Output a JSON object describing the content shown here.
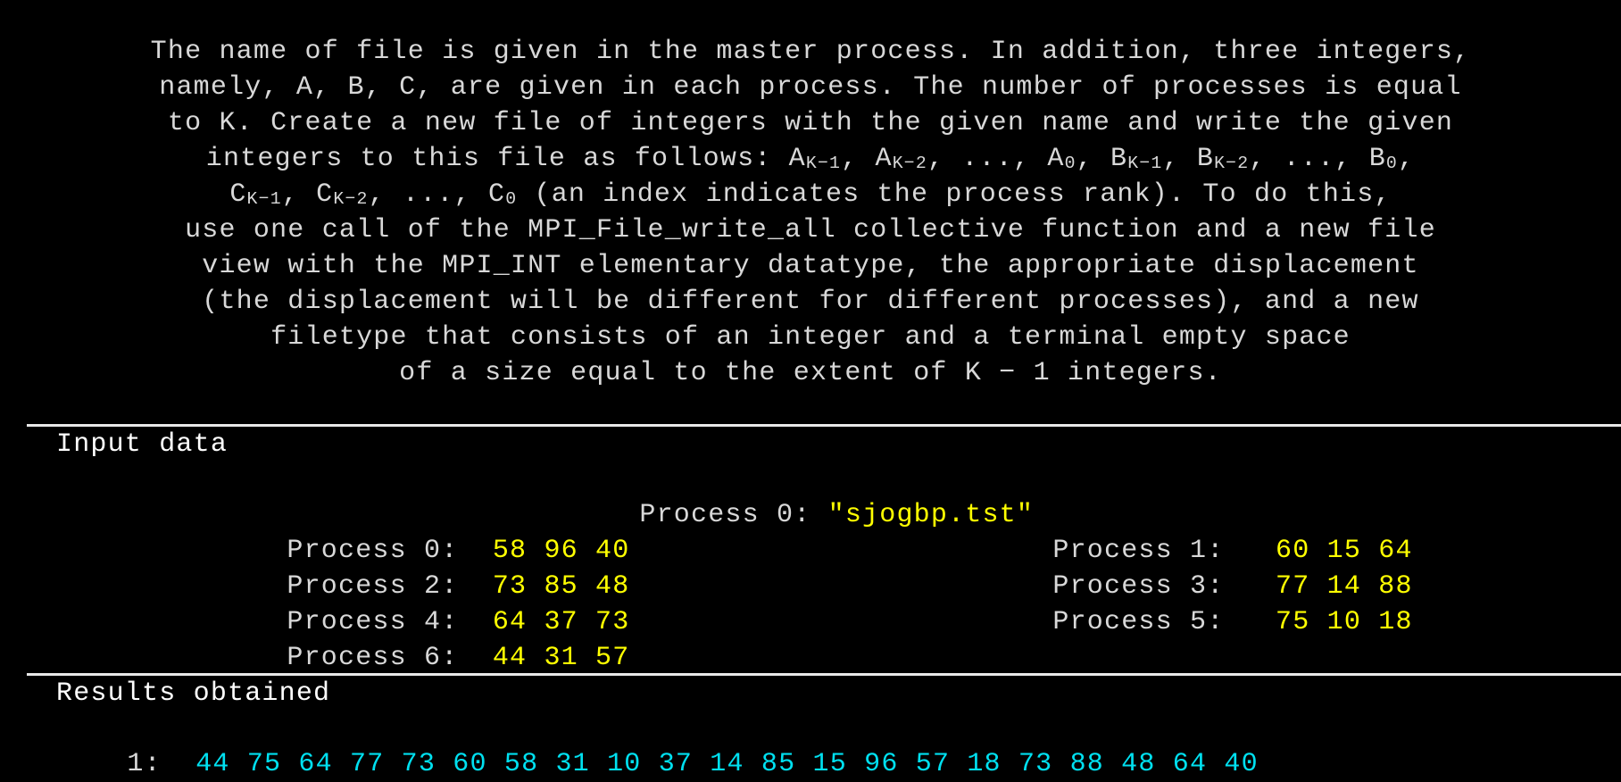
{
  "task": {
    "lines": [
      "The name of file is given in the master process. In addition, three integers,",
      "namely, A, B, C, are given in each process. The number of processes is equal",
      "to K. Create a new file of integers with the given name and write the given",
      "integers to this file as follows: A<sub>K−1</sub>, A<sub>K−2</sub>, ..., A<sub>0</sub>, B<sub>K−1</sub>, B<sub>K−2</sub>, ..., B<sub>0</sub>,",
      "C<sub>K−1</sub>, C<sub>K−2</sub>, ..., C<sub>0</sub> (an index indicates the process rank). To do this,",
      "use one call of the MPI_File_write_all collective function and a new file",
      "view with the MPI_INT elementary datatype, the appropriate displacement",
      "(the displacement will be different for different processes), and a new",
      "filetype that consists of an integer and a terminal empty space",
      "of a size equal to the extent of K − 1 integers."
    ]
  },
  "input": {
    "title": "Input data",
    "filename_label": "Process 0: ",
    "filename_value": "\"sjogbp.tst\"",
    "processes": [
      {
        "label": "Process 0:",
        "values": "58 96 40"
      },
      {
        "label": "Process 1:",
        "values": "60 15 64"
      },
      {
        "label": "Process 2:",
        "values": "73 85 48"
      },
      {
        "label": "Process 3:",
        "values": "77 14 88"
      },
      {
        "label": "Process 4:",
        "values": "64 37 73"
      },
      {
        "label": "Process 5:",
        "values": "75 10 18"
      },
      {
        "label": "Process 6:",
        "values": "44 31 57"
      }
    ]
  },
  "results": {
    "title": "Results obtained",
    "line_label": "1:",
    "values": "44 75 64 77 73 60 58 31 10 37 14 85 15 96 57 18 73 88 48 64 40"
  },
  "colors": {
    "background": "#000000",
    "text": "#d8d8d8",
    "input_value": "#ffff00",
    "result_value": "#00e0f0"
  }
}
